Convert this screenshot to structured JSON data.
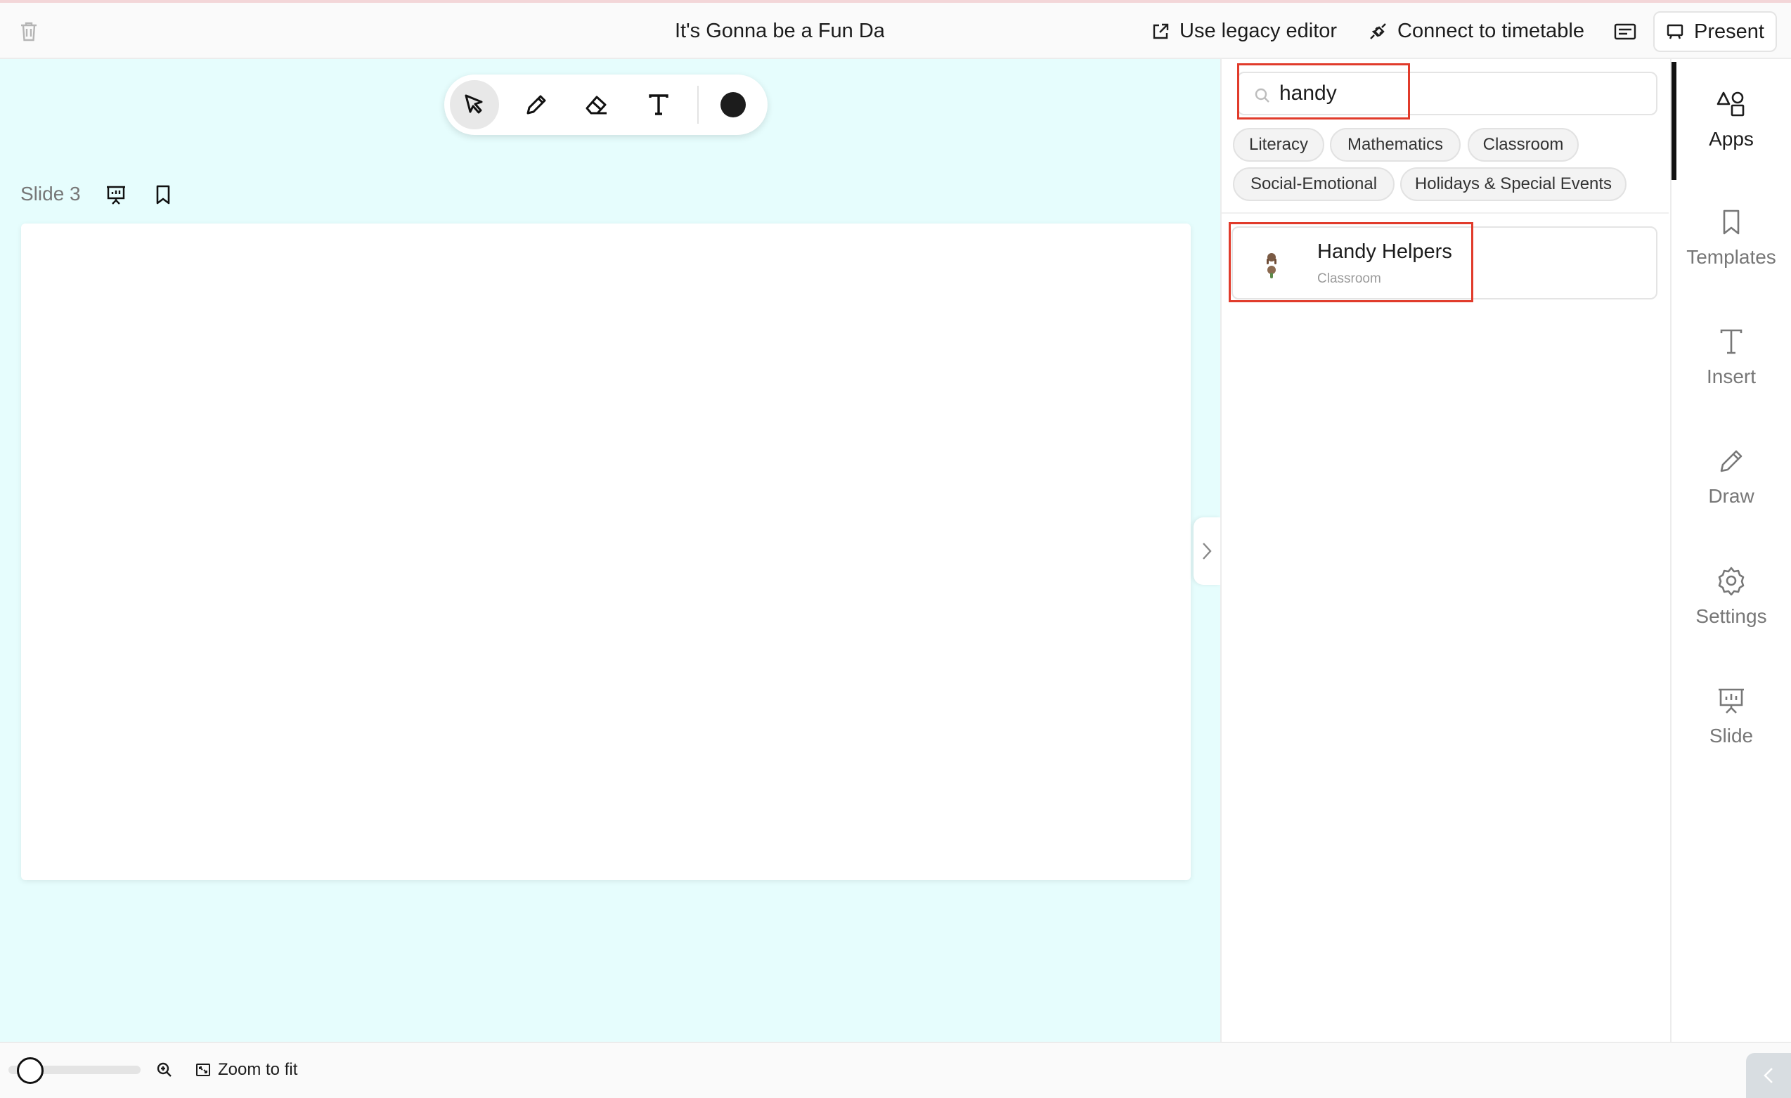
{
  "header": {
    "title": "It's Gonna be a Fun Day",
    "legacy_label": "Use legacy editor",
    "timetable_label": "Connect to timetable",
    "present_label": "Present"
  },
  "canvas": {
    "slide_label": "Slide 3",
    "background_color": "#e6fdfd",
    "draw_color": "#1c1c1c"
  },
  "panel": {
    "search_value": "handy",
    "chips": [
      "Literacy",
      "Mathematics",
      "Classroom",
      "Social-Emotional",
      "Holidays & Special Events"
    ],
    "results": [
      {
        "name": "Handy Helpers",
        "category": "Classroom"
      }
    ]
  },
  "rail": {
    "items": [
      {
        "label": "Apps",
        "icon": "shapes-icon",
        "active": true
      },
      {
        "label": "Templates",
        "icon": "bookmark-icon",
        "active": false
      },
      {
        "label": "Insert",
        "icon": "text-icon",
        "active": false
      },
      {
        "label": "Draw",
        "icon": "pencil-icon",
        "active": false
      },
      {
        "label": "Settings",
        "icon": "gear-icon",
        "active": false
      },
      {
        "label": "Slide",
        "icon": "presentation-icon",
        "active": false
      }
    ]
  },
  "bottom": {
    "zoom_fit_label": "Zoom to fit"
  },
  "highlight_color": "#e13b2b"
}
